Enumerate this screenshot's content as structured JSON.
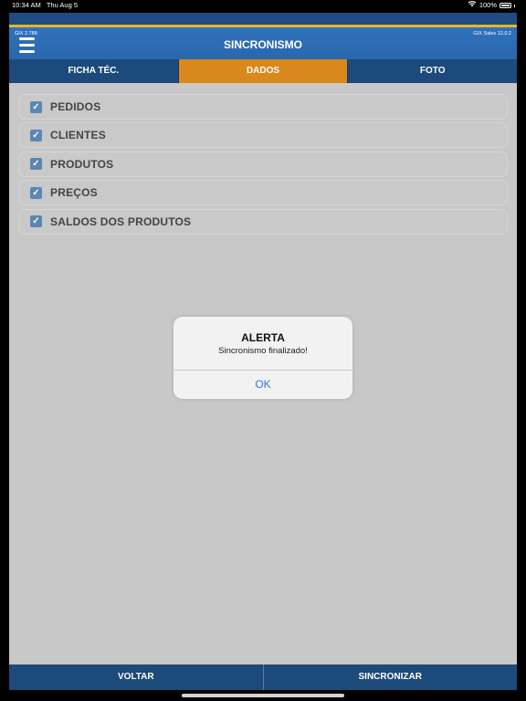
{
  "status_bar": {
    "time": "10:34 AM",
    "date": "Thu Aug 5",
    "battery": "100%",
    "icons": [
      "wifi-icon",
      "battery-icon"
    ]
  },
  "header": {
    "title": "SINCRONISMO",
    "version_left": "GIX 2.788",
    "version_right": "GIX Sales 12.0.2"
  },
  "tabs": [
    {
      "label": "FICHA TÉC.",
      "active": false
    },
    {
      "label": "DADOS",
      "active": true
    },
    {
      "label": "FOTO",
      "active": false
    }
  ],
  "items": [
    {
      "label": "PEDIDOS",
      "checked": true
    },
    {
      "label": "CLIENTES",
      "checked": true
    },
    {
      "label": "PRODUTOS",
      "checked": true
    },
    {
      "label": "PREÇOS",
      "checked": true
    },
    {
      "label": "SALDOS DOS PRODUTOS",
      "checked": true
    }
  ],
  "alert": {
    "title": "ALERTA",
    "message": "Sincronismo finalizado!",
    "ok_label": "OK"
  },
  "footer": {
    "back_label": "VOLTAR",
    "sync_label": "SINCRONIZAR"
  },
  "colors": {
    "header_blue": "#2a67ad",
    "accent_orange": "#d9881c",
    "tab_blue": "#1c4a7a",
    "background_gray": "#c8c8c8",
    "link_blue": "#2a7ce0"
  }
}
